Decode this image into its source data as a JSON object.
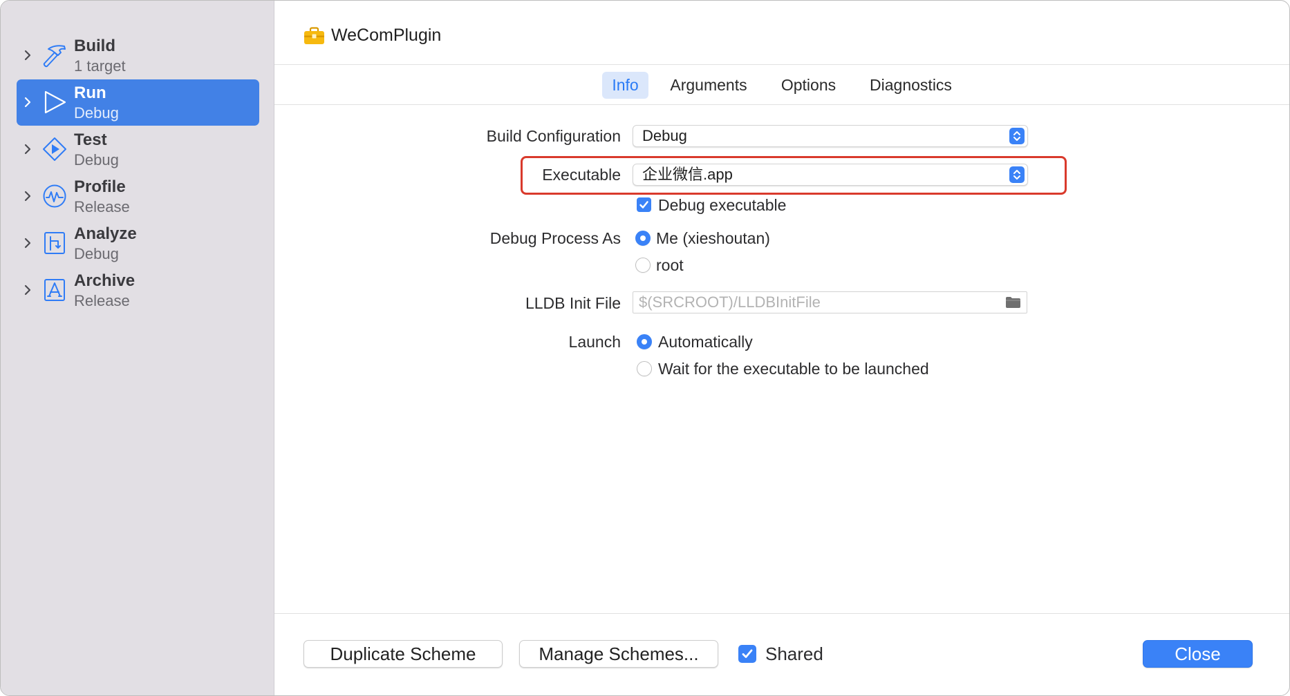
{
  "window": {
    "title": "WeComPlugin",
    "title_icon": "toolbox-icon"
  },
  "sidebar": {
    "items": [
      {
        "title": "Build",
        "subtitle": "1 target",
        "icon": "hammer-icon",
        "selected": false
      },
      {
        "title": "Run",
        "subtitle": "Debug",
        "icon": "play-icon",
        "selected": true
      },
      {
        "title": "Test",
        "subtitle": "Debug",
        "icon": "test-diamond-icon",
        "selected": false
      },
      {
        "title": "Profile",
        "subtitle": "Release",
        "icon": "profile-gauge-icon",
        "selected": false
      },
      {
        "title": "Analyze",
        "subtitle": "Debug",
        "icon": "analyze-icon",
        "selected": false
      },
      {
        "title": "Archive",
        "subtitle": "Release",
        "icon": "archive-icon",
        "selected": false
      }
    ]
  },
  "tabs": [
    {
      "label": "Info",
      "selected": true
    },
    {
      "label": "Arguments",
      "selected": false
    },
    {
      "label": "Options",
      "selected": false
    },
    {
      "label": "Diagnostics",
      "selected": false
    }
  ],
  "form": {
    "build_configuration": {
      "label": "Build Configuration",
      "value": "Debug"
    },
    "executable": {
      "label": "Executable",
      "value": "企业微信.app"
    },
    "debug_executable": {
      "label": "Debug executable",
      "checked": true
    },
    "debug_process_as": {
      "label": "Debug Process As",
      "options": [
        {
          "label": "Me (xieshoutan)",
          "selected": true
        },
        {
          "label": "root",
          "selected": false
        }
      ]
    },
    "lldb_init_file": {
      "label": "LLDB Init File",
      "placeholder": "$(SRCROOT)/LLDBInitFile",
      "icon": "folder-icon"
    },
    "launch": {
      "label": "Launch",
      "options": [
        {
          "label": "Automatically",
          "selected": true
        },
        {
          "label": "Wait for the executable to be launched",
          "selected": false
        }
      ]
    }
  },
  "footer": {
    "duplicate_label": "Duplicate Scheme",
    "manage_label": "Manage Schemes...",
    "shared_label": "Shared",
    "shared_checked": true,
    "close_label": "Close"
  },
  "colors": {
    "accent": "#3a82f7",
    "selection": "#4281e6",
    "highlight": "#d93a2c",
    "sidebar": "#e2dfe4",
    "icon": "#2f7cf6"
  }
}
